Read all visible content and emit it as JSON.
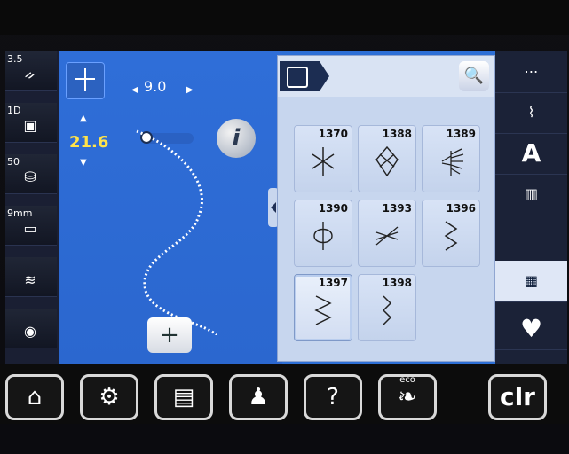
{
  "left_panel": {
    "items": [
      {
        "label": "3.5",
        "icon": "needle-stop-icon"
      },
      {
        "label": "1D",
        "icon": "presser-foot-icon"
      },
      {
        "label": "50",
        "icon": "thread-tension-icon"
      },
      {
        "label": "9mm",
        "icon": "stitch-plate-icon"
      },
      {
        "label": "",
        "icon": "feed-dog-icon"
      },
      {
        "label": "",
        "icon": "bobbin-icon"
      }
    ]
  },
  "stitch_settings": {
    "width_value": "9.0",
    "length_value": "21.6",
    "info_label": "i",
    "add_label": "+"
  },
  "stitch_panel": {
    "search_icon": "search-icon",
    "stitches": [
      {
        "id": "1370"
      },
      {
        "id": "1388"
      },
      {
        "id": "1389"
      },
      {
        "id": "1390"
      },
      {
        "id": "1393"
      },
      {
        "id": "1396"
      },
      {
        "id": "1397"
      },
      {
        "id": "1398"
      }
    ],
    "selected_stitch": "1397"
  },
  "right_panel": {
    "items": [
      {
        "icon": "practical-stitches-icon"
      },
      {
        "icon": "decorative-stitches-icon"
      },
      {
        "icon": "alphabet-icon"
      },
      {
        "icon": "buttonhole-icon"
      },
      {
        "icon": "quilt-stitches-icon"
      },
      {
        "icon": "favorites-icon"
      }
    ],
    "selected": "quilt-stitches-icon"
  },
  "toolbar": {
    "eco_label": "eco",
    "clr_label": "clr",
    "help_label": "?"
  },
  "colors": {
    "ui_blue": "#2d6fd6",
    "panel_blue": "#cfdcf1",
    "yellow": "#ffe34a"
  }
}
